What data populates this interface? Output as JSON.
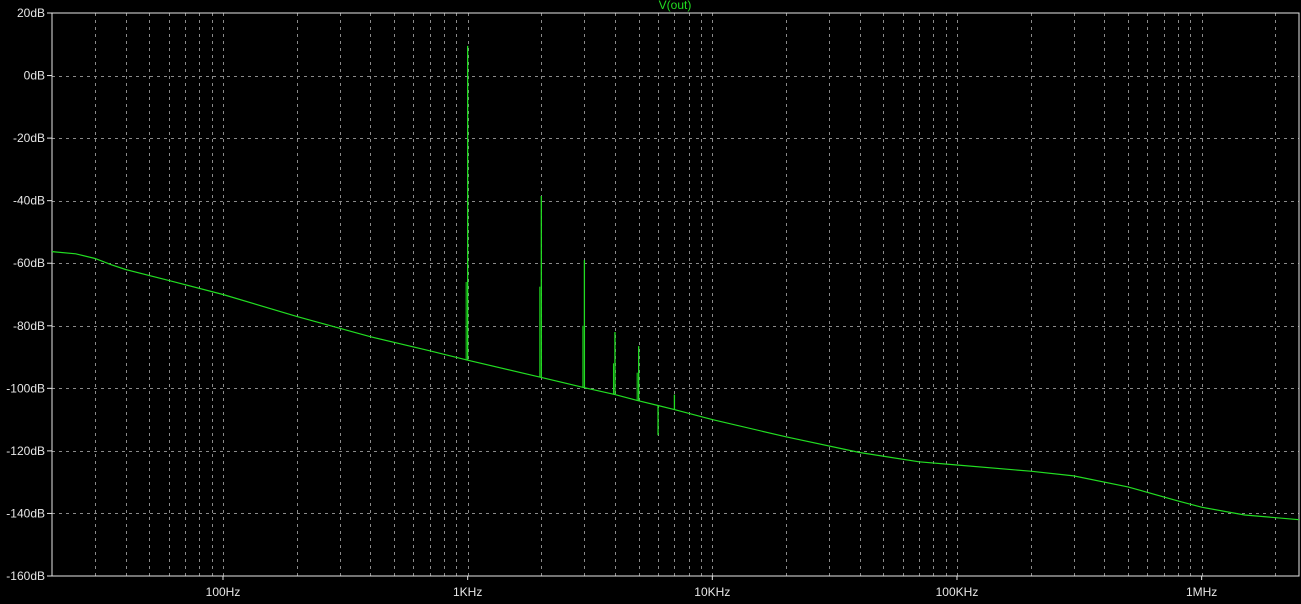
{
  "chart_data": {
    "type": "line",
    "title": "V(out)",
    "xscale": "log",
    "xlim": [
      20,
      2500000
    ],
    "ylim": [
      -160,
      20
    ],
    "x_ticks": [
      {
        "value": 100,
        "label": "100Hz"
      },
      {
        "value": 1000,
        "label": "1KHz"
      },
      {
        "value": 10000,
        "label": "10KHz"
      },
      {
        "value": 100000,
        "label": "100KHz"
      },
      {
        "value": 1000000,
        "label": "1MHz"
      }
    ],
    "y_ticks": [
      {
        "value": 20,
        "label": "20dB"
      },
      {
        "value": 0,
        "label": "0dB"
      },
      {
        "value": -20,
        "label": "-20dB"
      },
      {
        "value": -40,
        "label": "-40dB"
      },
      {
        "value": -60,
        "label": "-60dB"
      },
      {
        "value": -80,
        "label": "-80dB"
      },
      {
        "value": -100,
        "label": "-100dB"
      },
      {
        "value": -120,
        "label": "-120dB"
      },
      {
        "value": -140,
        "label": "-140dB"
      },
      {
        "value": -160,
        "label": "-160dB"
      }
    ],
    "grid": true,
    "series": [
      {
        "name": "V(out)",
        "color": "#22dd22",
        "noise_floor": [
          [
            20,
            -56.3
          ],
          [
            25,
            -57
          ],
          [
            30,
            -58.5
          ],
          [
            35,
            -60.5
          ],
          [
            40,
            -62
          ],
          [
            60,
            -65.5
          ],
          [
            100,
            -70
          ],
          [
            200,
            -77
          ],
          [
            400,
            -83.5
          ],
          [
            700,
            -88
          ],
          [
            1000,
            -91
          ],
          [
            2000,
            -96.5
          ],
          [
            3000,
            -99.8
          ],
          [
            4000,
            -102
          ],
          [
            5000,
            -104
          ],
          [
            6000,
            -105.5
          ],
          [
            7000,
            -106.8
          ],
          [
            10000,
            -110
          ],
          [
            20000,
            -115.5
          ],
          [
            40000,
            -120.5
          ],
          [
            70000,
            -123.5
          ],
          [
            100000,
            -124.5
          ],
          [
            200000,
            -126.5
          ],
          [
            300000,
            -128
          ],
          [
            500000,
            -131.5
          ],
          [
            800000,
            -136
          ],
          [
            1000000,
            -138
          ],
          [
            1500000,
            -140.5
          ],
          [
            2500000,
            -142
          ]
        ],
        "peaks": [
          {
            "f": 1000,
            "floor": -91,
            "peak": 9.5,
            "shoulder": -66
          },
          {
            "f": 2000,
            "floor": -96.5,
            "peak": -38.5,
            "shoulder": -67.5
          },
          {
            "f": 3000,
            "floor": -99.8,
            "peak": -59,
            "shoulder": -80
          },
          {
            "f": 4000,
            "floor": -102,
            "peak": -82,
            "shoulder": -92
          },
          {
            "f": 5000,
            "floor": -104,
            "peak": -86.5,
            "shoulder": -95
          },
          {
            "f": 6000,
            "floor": -105.5,
            "peak": -115,
            "shoulder": -115
          },
          {
            "f": 7000,
            "floor": -106.8,
            "peak": -102,
            "shoulder": -102
          }
        ]
      }
    ]
  }
}
